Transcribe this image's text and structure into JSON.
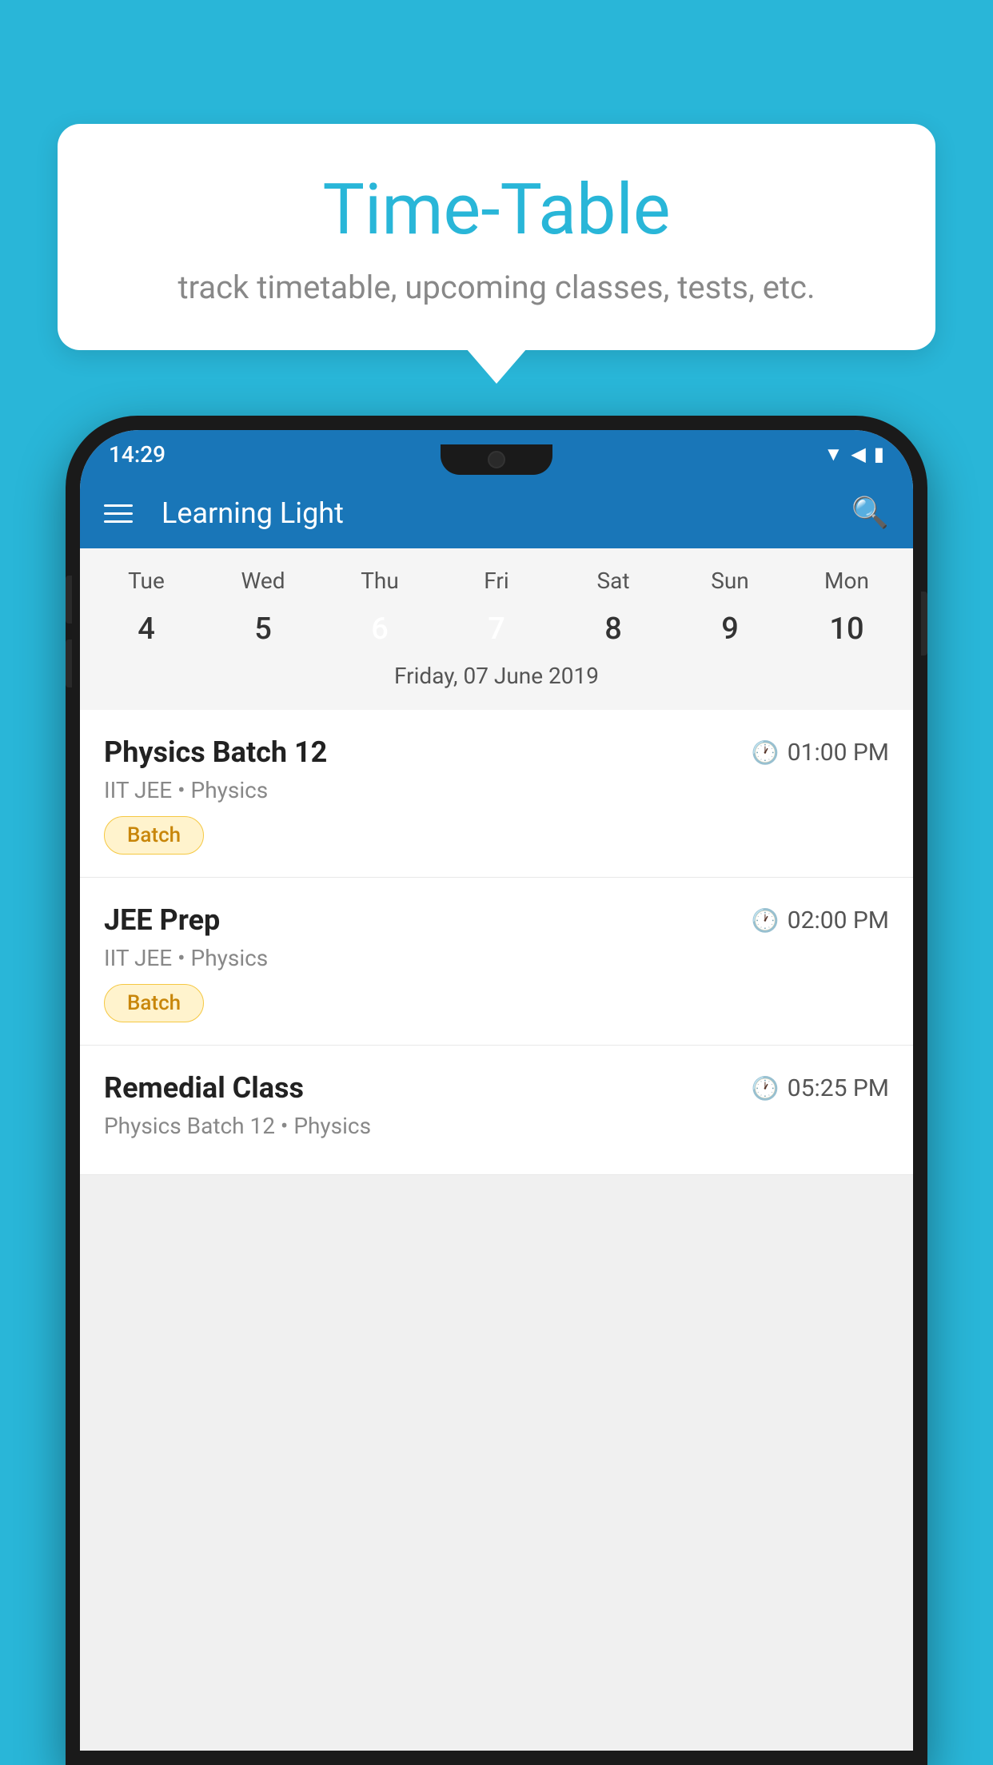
{
  "background_color": "#29B6D8",
  "bubble": {
    "title": "Time-Table",
    "subtitle": "track timetable, upcoming classes, tests, etc."
  },
  "phone": {
    "status_bar": {
      "time": "14:29"
    },
    "app_bar": {
      "title": "Learning Light"
    },
    "calendar": {
      "days": [
        {
          "label": "Tue",
          "number": "4",
          "state": "normal"
        },
        {
          "label": "Wed",
          "number": "5",
          "state": "normal"
        },
        {
          "label": "Thu",
          "number": "6",
          "state": "today"
        },
        {
          "label": "Fri",
          "number": "7",
          "state": "selected"
        },
        {
          "label": "Sat",
          "number": "8",
          "state": "normal"
        },
        {
          "label": "Sun",
          "number": "9",
          "state": "normal"
        },
        {
          "label": "Mon",
          "number": "10",
          "state": "normal"
        }
      ],
      "selected_date_label": "Friday, 07 June 2019"
    },
    "schedule": [
      {
        "title": "Physics Batch 12",
        "time": "01:00 PM",
        "subtitle": "IIT JEE • Physics",
        "badge": "Batch"
      },
      {
        "title": "JEE Prep",
        "time": "02:00 PM",
        "subtitle": "IIT JEE • Physics",
        "badge": "Batch"
      },
      {
        "title": "Remedial Class",
        "time": "05:25 PM",
        "subtitle": "Physics Batch 12 • Physics",
        "badge": null
      }
    ]
  }
}
